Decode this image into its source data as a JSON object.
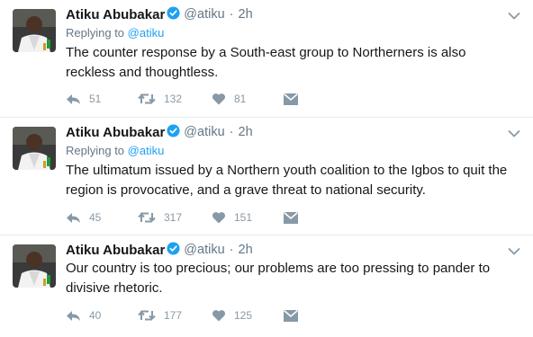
{
  "tweets": [
    {
      "name": "Atiku Abubakar",
      "handle": "@atiku",
      "dot": "·",
      "time": "2h",
      "replying_prefix": "Replying to ",
      "replying_handle": "@atiku",
      "text": "The counter response by a South-east group to Northerners is also reckless and thoughtless.",
      "replies": "51",
      "retweets": "132",
      "likes": "81"
    },
    {
      "name": "Atiku Abubakar",
      "handle": "@atiku",
      "dot": "·",
      "time": "2h",
      "replying_prefix": "Replying to ",
      "replying_handle": "@atiku",
      "text": "The ultimatum issued by a Northern youth coalition to the Igbos to quit the region is provocative, and a grave threat to national security.",
      "replies": "45",
      "retweets": "317",
      "likes": "151"
    },
    {
      "name": "Atiku Abubakar",
      "handle": "@atiku",
      "dot": "·",
      "time": "2h",
      "text": "Our country is too precious; our problems are too pressing to pander to divisive rhetoric.",
      "replies": "40",
      "retweets": "177",
      "likes": "125"
    }
  ],
  "colors": {
    "text": "#14171a",
    "muted": "#657786",
    "icon": "#8899a6",
    "link": "#1da1f2",
    "verified": "#1da1f2",
    "divider": "#e6ecf0"
  }
}
